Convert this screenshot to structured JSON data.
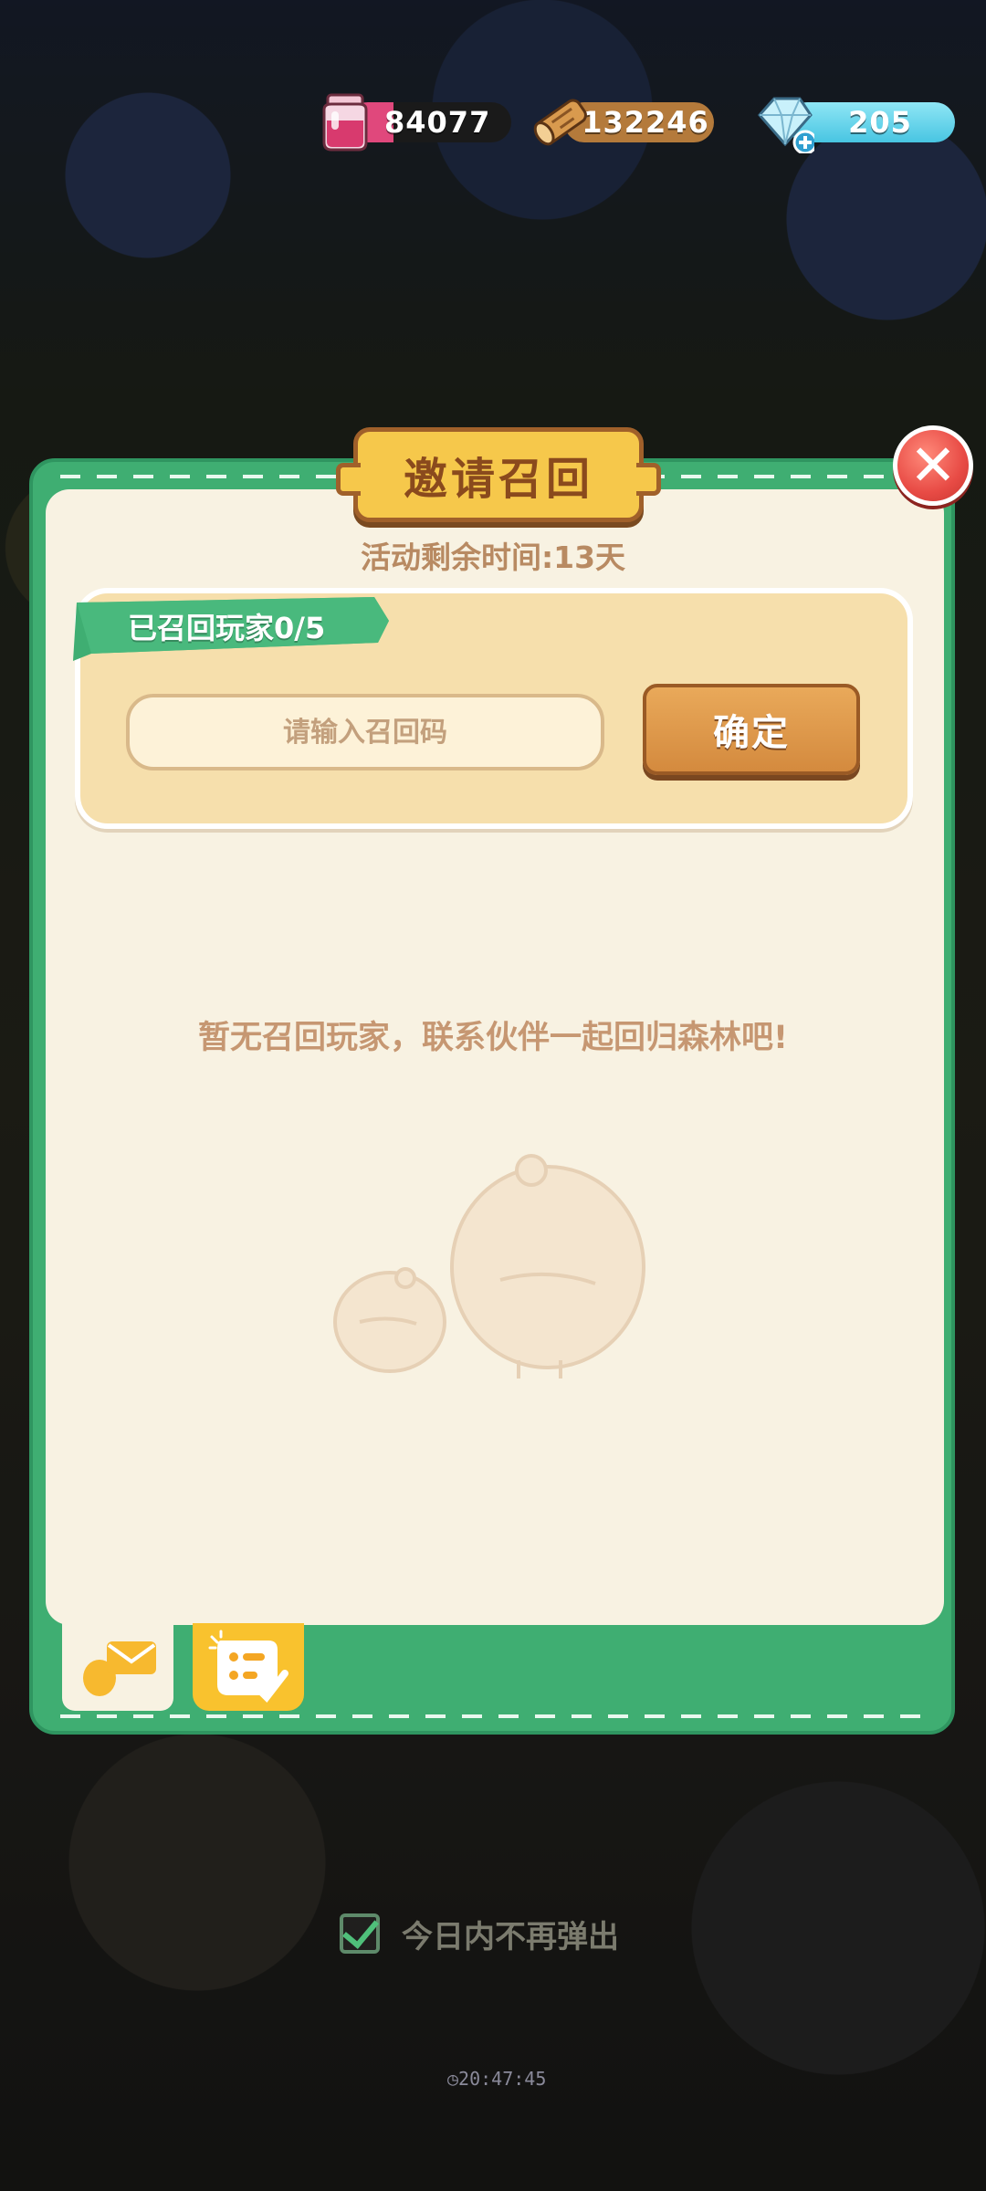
{
  "resources": {
    "jam": {
      "value": "84077",
      "icon": "jam-jar-icon"
    },
    "wood": {
      "value": "132246",
      "icon": "wood-log-icon"
    },
    "gems": {
      "value": "205",
      "icon": "diamond-plus-icon"
    }
  },
  "dialog": {
    "title": "邀请召回",
    "time_left": "活动剩余时间:13天",
    "recalled_label": "已召回玩家0/5",
    "input_placeholder": "请输入召回码",
    "input_value": "",
    "confirm_label": "确定",
    "empty_message": "暂无召回玩家，联系伙伴一起回归森林吧!",
    "close_icon": "close-icon"
  },
  "tabs": [
    {
      "name": "recall",
      "icon": "invite-mail-icon",
      "selected": true
    },
    {
      "name": "tasks",
      "icon": "task-list-icon",
      "selected": false
    }
  ],
  "footer": {
    "dont_show_label": "今日内不再弹出",
    "dont_show_checked": true,
    "timer": "20:47:45"
  },
  "colors": {
    "frame_green": "#3fae72",
    "panel_cream": "#f8f2e2",
    "title_gold": "#f6c84b",
    "confirm_orange": "#d48a3e",
    "close_red": "#e84b45"
  }
}
